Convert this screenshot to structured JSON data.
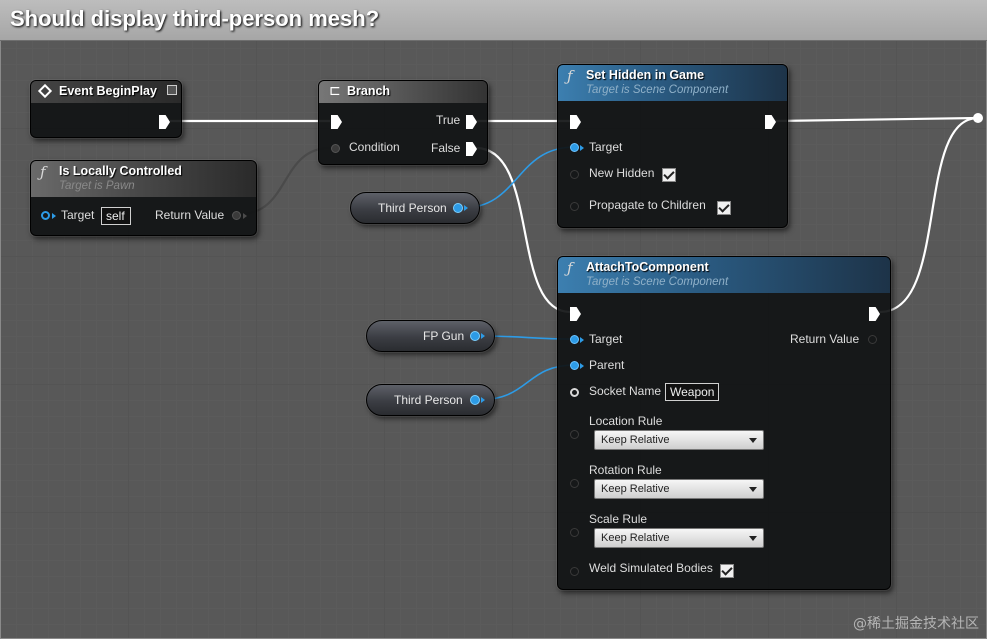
{
  "comment": {
    "title": "Should display third-person mesh?"
  },
  "nodes": {
    "event_begin_play": {
      "title": "Event BeginPlay"
    },
    "is_locally_controlled": {
      "title": "Is Locally Controlled",
      "subtitle": "Target is Pawn",
      "target_label": "Target",
      "target_value": "self",
      "return_label": "Return Value"
    },
    "branch": {
      "title": "Branch",
      "condition_label": "Condition",
      "true_label": "True",
      "false_label": "False"
    },
    "set_hidden_in_game": {
      "title": "Set Hidden in Game",
      "subtitle": "Target is Scene Component",
      "target_label": "Target",
      "new_hidden_label": "New Hidden",
      "new_hidden_checked": true,
      "propagate_label": "Propagate to Children",
      "propagate_checked": true
    },
    "attach_to_component": {
      "title": "AttachToComponent",
      "subtitle": "Target is Scene Component",
      "target_label": "Target",
      "return_label": "Return Value",
      "parent_label": "Parent",
      "socket_label": "Socket Name",
      "socket_value": "Weapon",
      "location_rule_label": "Location Rule",
      "location_rule_value": "Keep Relative",
      "rotation_rule_label": "Rotation Rule",
      "rotation_rule_value": "Keep Relative",
      "scale_rule_label": "Scale Rule",
      "scale_rule_value": "Keep Relative",
      "weld_label": "Weld Simulated Bodies",
      "weld_checked": true
    }
  },
  "variables": {
    "third_person_1": "Third Person",
    "fp_gun": "FP Gun",
    "third_person_2": "Third Person"
  },
  "colors": {
    "object_pin": "#2d9be6",
    "exec_wire": "#ffffff",
    "bool_wire": "#4a4a4a"
  },
  "watermark": "@稀土掘金技术社区"
}
